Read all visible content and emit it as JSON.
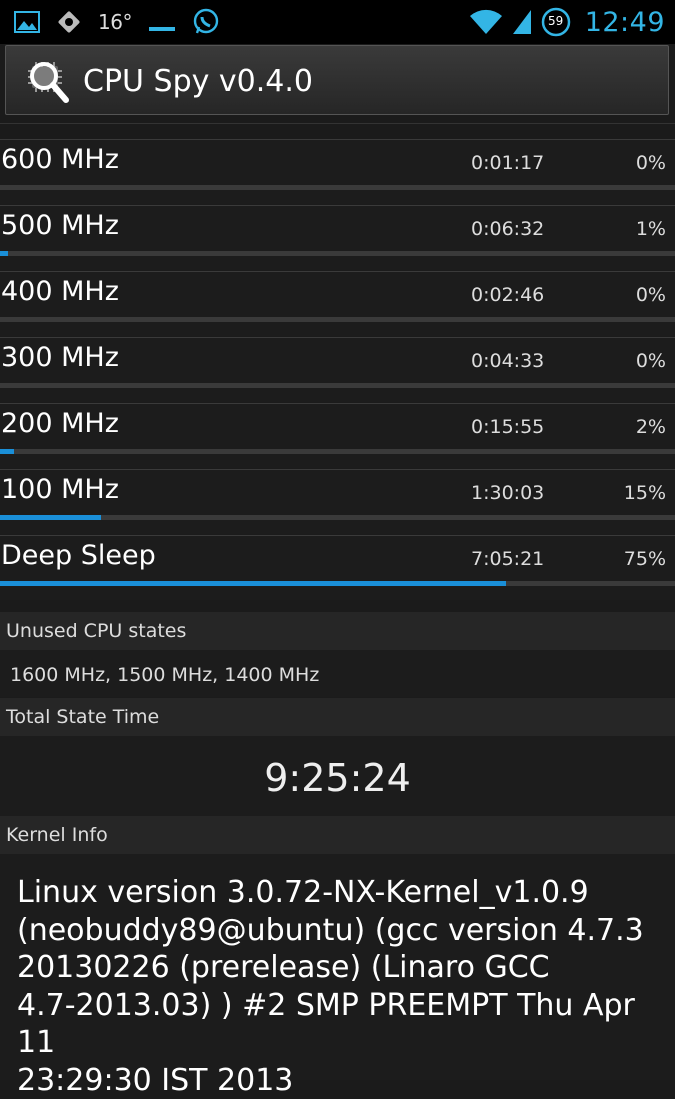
{
  "status_bar": {
    "temperature": "16°",
    "battery_level": "59",
    "time": "12:49",
    "left_icons": [
      "gallery-icon",
      "settings-icon",
      "temperature",
      "keyboard-icon",
      "whatsapp-icon"
    ],
    "right_icons": [
      "wifi-icon",
      "signal-icon",
      "battery-icon"
    ],
    "accent_color": "#33b5e5"
  },
  "app": {
    "title": "CPU Spy v0.4.0",
    "icon": "cpu-magnifier-icon"
  },
  "states": [
    {
      "name": "600 MHz",
      "duration": "0:01:17",
      "percent": "0%",
      "fill": 0.0
    },
    {
      "name": "500 MHz",
      "duration": "0:06:32",
      "percent": "1%",
      "fill": 0.01
    },
    {
      "name": "400 MHz",
      "duration": "0:02:46",
      "percent": "0%",
      "fill": 0.0
    },
    {
      "name": "300 MHz",
      "duration": "0:04:33",
      "percent": "0%",
      "fill": 0.0
    },
    {
      "name": "200 MHz",
      "duration": "0:15:55",
      "percent": "2%",
      "fill": 0.02
    },
    {
      "name": "100 MHz",
      "duration": "1:30:03",
      "percent": "15%",
      "fill": 0.15
    },
    {
      "name": "Deep Sleep",
      "duration": "7:05:21",
      "percent": "75%",
      "fill": 0.75
    }
  ],
  "bar_color": "#1a8fd8",
  "unused": {
    "header": "Unused CPU states",
    "value": "1600 MHz, 1500 MHz, 1400 MHz"
  },
  "total": {
    "header": "Total State Time",
    "value": "9:25:24"
  },
  "kernel": {
    "header": "Kernel Info",
    "value": "Linux version 3.0.72-NX-Kernel_v1.0.9\n(neobuddy89@ubuntu) (gcc version 4.7.3\n20130226 (prerelease) (Linaro GCC\n4.7-2013.03) ) #2 SMP PREEMPT Thu Apr 11\n23:29:30 IST 2013"
  }
}
